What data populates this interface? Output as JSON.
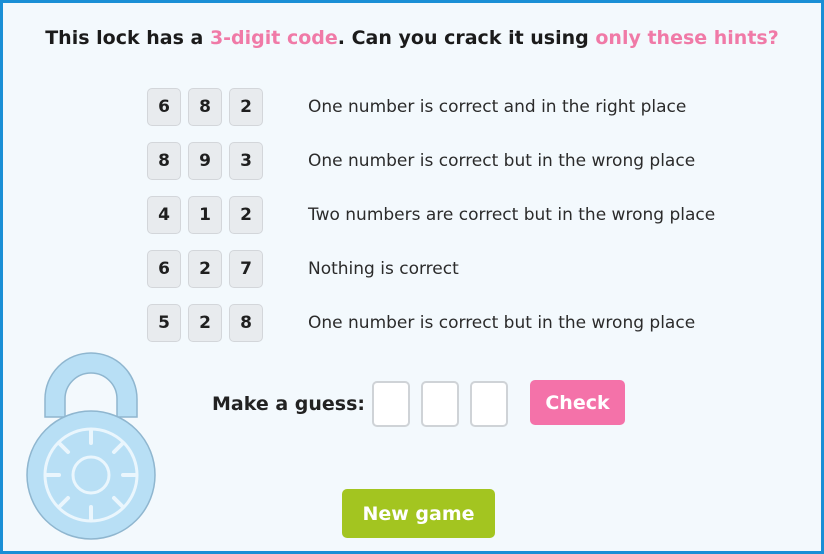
{
  "headline": {
    "part1": "This lock has a ",
    "highlight1": "3-digit code",
    "part2": ". Can you crack it using ",
    "highlight2": "only these hints?"
  },
  "hints": [
    {
      "digits": [
        "6",
        "8",
        "2"
      ],
      "text": "One number is correct and in the right place"
    },
    {
      "digits": [
        "8",
        "9",
        "3"
      ],
      "text": "One number is correct but in the wrong place"
    },
    {
      "digits": [
        "4",
        "1",
        "2"
      ],
      "text": "Two numbers are correct but in the wrong place"
    },
    {
      "digits": [
        "6",
        "2",
        "7"
      ],
      "text": "Nothing is correct"
    },
    {
      "digits": [
        "5",
        "2",
        "8"
      ],
      "text": "One number is correct but in the wrong place"
    }
  ],
  "guess": {
    "label": "Make a guess:",
    "values": [
      "",
      "",
      ""
    ]
  },
  "buttons": {
    "check": "Check",
    "new_game": "New game"
  },
  "colors": {
    "border": "#1a8fd6",
    "highlight": "#f07aa7",
    "check_button": "#f472a9",
    "new_game_button": "#a3c520",
    "lock": "#b8dff5"
  },
  "icons": {
    "lock": "padlock-icon"
  }
}
